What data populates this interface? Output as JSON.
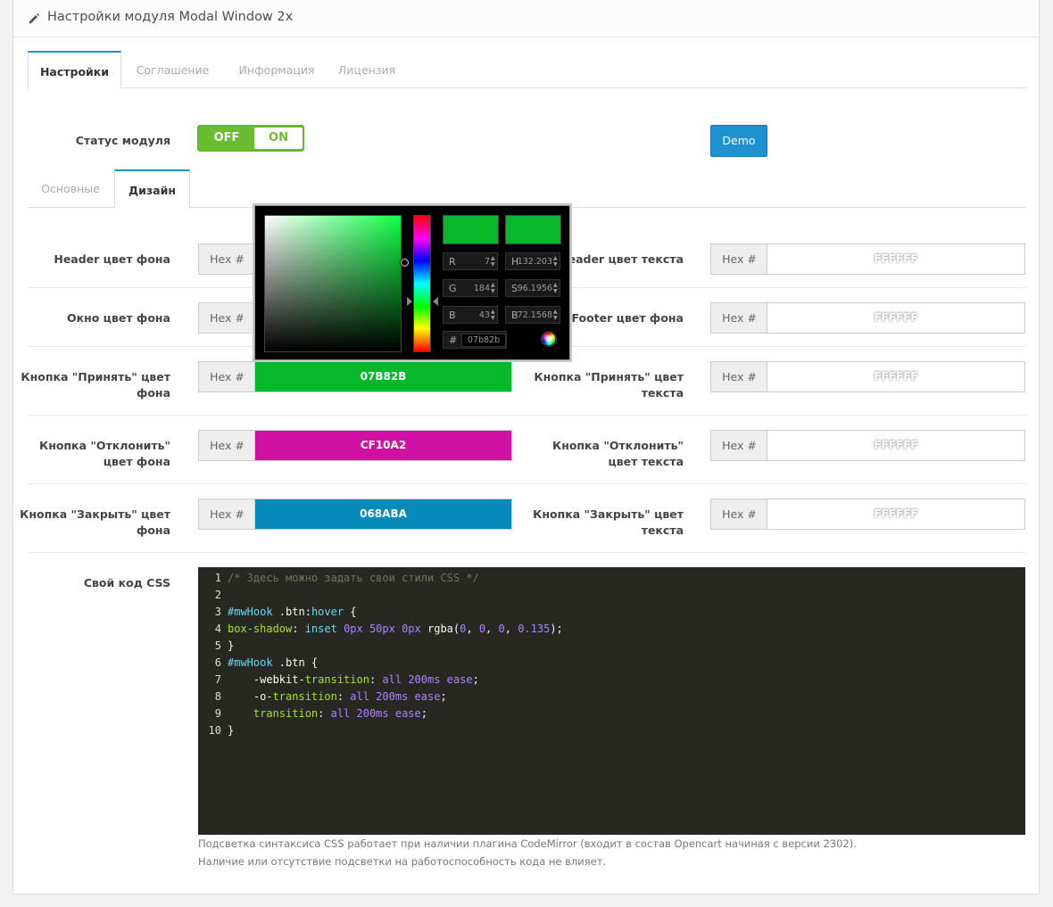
{
  "panel": {
    "title": "Настройки модуля Modal Window 2x"
  },
  "main_tabs": [
    "Настройки",
    "Соглашение",
    "Информация",
    "Лицензия"
  ],
  "status": {
    "label": "Статус модуля",
    "off": "OFF",
    "on": "ON"
  },
  "demo_button": "Demo",
  "sub_tabs": [
    "Основные",
    "Дизайн"
  ],
  "hex_addon": "Hex #",
  "fields": {
    "header_bg": {
      "label": "Header цвет фона",
      "value": "07B82B"
    },
    "header_text": {
      "label": "Header цвет текста",
      "value": "FFFFFF"
    },
    "window_bg": {
      "label": "Окно цвет фона",
      "value": ""
    },
    "footer_bg": {
      "label": "Footer цвет фона",
      "value": "FFFFFF"
    },
    "accept_bg": {
      "label1": "Кнопка \"Принять\" цвет",
      "label2": "фона",
      "value": "07B82B",
      "color": "#07b82b"
    },
    "accept_text": {
      "label1": "Кнопка \"Принять\" цвет",
      "label2": "текста",
      "value": "FFFFFF"
    },
    "decline_bg": {
      "label1": "Кнопка \"Отклонить\"",
      "label2": "цвет фона",
      "value": "CF10A2",
      "color": "#cf10a2"
    },
    "decline_text": {
      "label1": "Кнопка \"Отклонить\"",
      "label2": "цвет текста",
      "value": "FFFFFF"
    },
    "close_bg": {
      "label1": "Кнопка \"Закрыть\" цвет",
      "label2": "фона",
      "value": "068ABA",
      "color": "#068aba"
    },
    "close_text": {
      "label1": "Кнопка \"Закрыть\" цвет",
      "label2": "текста",
      "value": "FFFFFF"
    }
  },
  "picker": {
    "r": "7",
    "g": "184",
    "b": "43",
    "h": "132.203",
    "s": "96.1956",
    "bv": "72.1568",
    "hex": "07b82b",
    "new_color": "#07b82b",
    "current_color": "#07b82b"
  },
  "css_label": "Свой код CSS",
  "code_lines": [
    {
      "n": "1",
      "t": "/* Здесь можно задать свои стили CSS */"
    },
    {
      "n": "2",
      "t": ""
    },
    {
      "n": "3",
      "t": "#mwHook .btn:hover {"
    },
    {
      "n": "4",
      "t": "box-shadow: inset 0px 50px 0px rgba(0, 0, 0, 0.135);"
    },
    {
      "n": "5",
      "t": "}"
    },
    {
      "n": "6",
      "t": "#mwHook .btn {"
    },
    {
      "n": "7",
      "t": "    -webkit-transition: all 200ms ease;"
    },
    {
      "n": "8",
      "t": "    -o-transition: all 200ms ease;"
    },
    {
      "n": "9",
      "t": "    transition: all 200ms ease;"
    },
    {
      "n": "10",
      "t": "}"
    }
  ],
  "help": [
    "Подсветка синтаксиса CSS работает при наличии плагина CodeMirror (входит в состав Opencart начиная с версии 2302).",
    "Наличие или отсутствие подсветки на работоспособность кода не влияет."
  ]
}
